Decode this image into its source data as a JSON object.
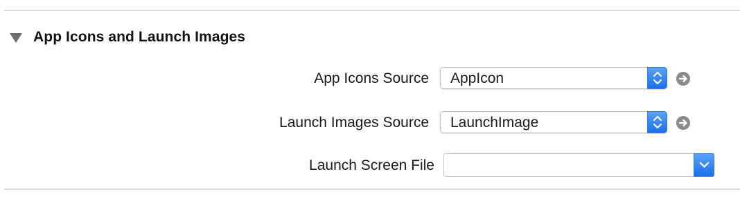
{
  "section": {
    "title": "App Icons and Launch Images"
  },
  "rows": {
    "app_icons": {
      "label": "App Icons Source",
      "value": "AppIcon"
    },
    "launch_images": {
      "label": "Launch Images Source",
      "value": "LaunchImage"
    },
    "launch_screen": {
      "label": "Launch Screen File",
      "value": ""
    }
  },
  "icons": {
    "disclosure": "disclosure-triangle-down-icon",
    "stepper": "up-down-chevron-icon",
    "go": "arrow-right-circle-icon",
    "dropdown": "chevron-down-icon"
  },
  "colors": {
    "accent": "#2f7ae6",
    "divider": "#dcdcdc",
    "go_button": "#8a8a8a"
  }
}
